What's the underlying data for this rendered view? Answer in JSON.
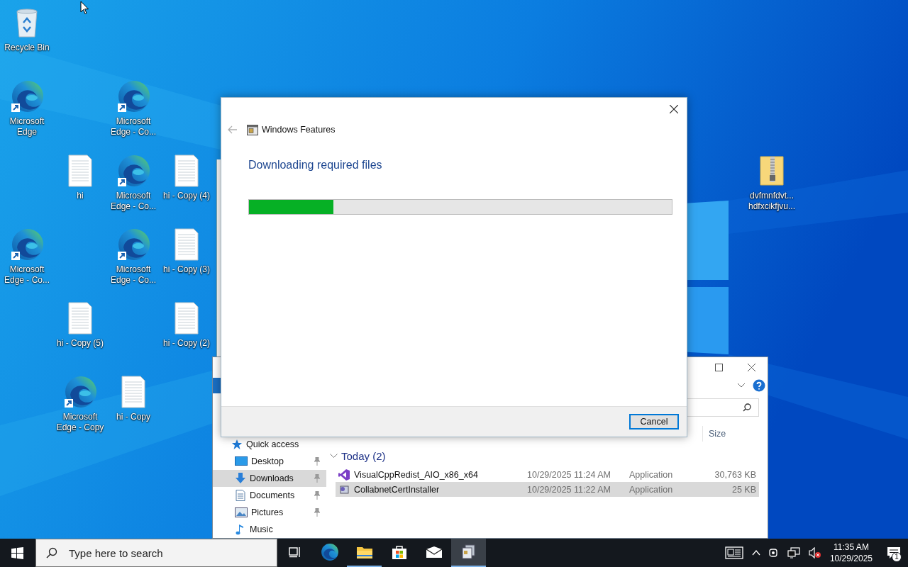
{
  "desktop": {
    "icons": [
      {
        "label": "Recycle Bin",
        "kind": "recycle-bin"
      },
      {
        "label": "Microsoft Edge",
        "kind": "edge"
      },
      {
        "label": "Microsoft Edge - Co...",
        "kind": "edge"
      },
      {
        "label": "hi",
        "kind": "text-file"
      },
      {
        "label": "Microsoft Edge - Co...",
        "kind": "edge"
      },
      {
        "label": "hi - Copy (4)",
        "kind": "text-file"
      },
      {
        "label": "Microsoft Edge - Co...",
        "kind": "edge"
      },
      {
        "label": "Microsoft Edge - Co...",
        "kind": "edge"
      },
      {
        "label": "hi - Copy (3)",
        "kind": "text-file"
      },
      {
        "label": "hi - Copy (5)",
        "kind": "text-file"
      },
      {
        "label": "hi - Copy (2)",
        "kind": "text-file"
      },
      {
        "label": "Microsoft Edge - Copy",
        "kind": "edge"
      },
      {
        "label": "hi - Copy",
        "kind": "text-file"
      },
      {
        "label": "dvfmnfdvt... hdfxcikfjvu...",
        "kind": "zip"
      }
    ]
  },
  "explorer": {
    "nav": [
      {
        "label": "Quick access",
        "kind": "star",
        "pinned": false,
        "selected": false
      },
      {
        "label": "Desktop",
        "kind": "desktop",
        "pinned": true,
        "selected": false
      },
      {
        "label": "Downloads",
        "kind": "downloads",
        "pinned": true,
        "selected": true
      },
      {
        "label": "Documents",
        "kind": "documents",
        "pinned": true,
        "selected": false
      },
      {
        "label": "Pictures",
        "kind": "pictures",
        "pinned": true,
        "selected": false
      },
      {
        "label": "Music",
        "kind": "music",
        "pinned": false,
        "selected": false
      }
    ],
    "columns": [
      "Size"
    ],
    "group": "Today (2)",
    "files": [
      {
        "name": "VisualCppRedist_AIO_x86_x64",
        "date": "10/29/2025 11:24 AM",
        "type": "Application",
        "size": "30,763 KB",
        "kind": "visual-studio",
        "selected": false
      },
      {
        "name": "CollabnetCertInstaller",
        "date": "10/29/2025 11:22 AM",
        "type": "Application",
        "size": "25 KB",
        "kind": "installer",
        "selected": true
      }
    ]
  },
  "dialog": {
    "title": "Windows Features",
    "heading": "Downloading required files",
    "progress": {
      "level": 0.2
    },
    "buttons": [
      "Cancel"
    ]
  },
  "taskbar": {
    "search": {
      "placeholder": "Type here to search"
    },
    "apps": [
      {
        "kind": "task-view",
        "running": false,
        "selected": false
      },
      {
        "kind": "edge",
        "running": false,
        "selected": false
      },
      {
        "kind": "explorer",
        "running": true,
        "selected": false
      },
      {
        "kind": "store",
        "running": false,
        "selected": false
      },
      {
        "kind": "mail",
        "running": false,
        "selected": false
      },
      {
        "kind": "features",
        "running": true,
        "selected": true
      }
    ],
    "clock": {
      "time": "11:35 AM",
      "date": "10/29/2025"
    },
    "notifications": {
      "count": "1"
    }
  }
}
